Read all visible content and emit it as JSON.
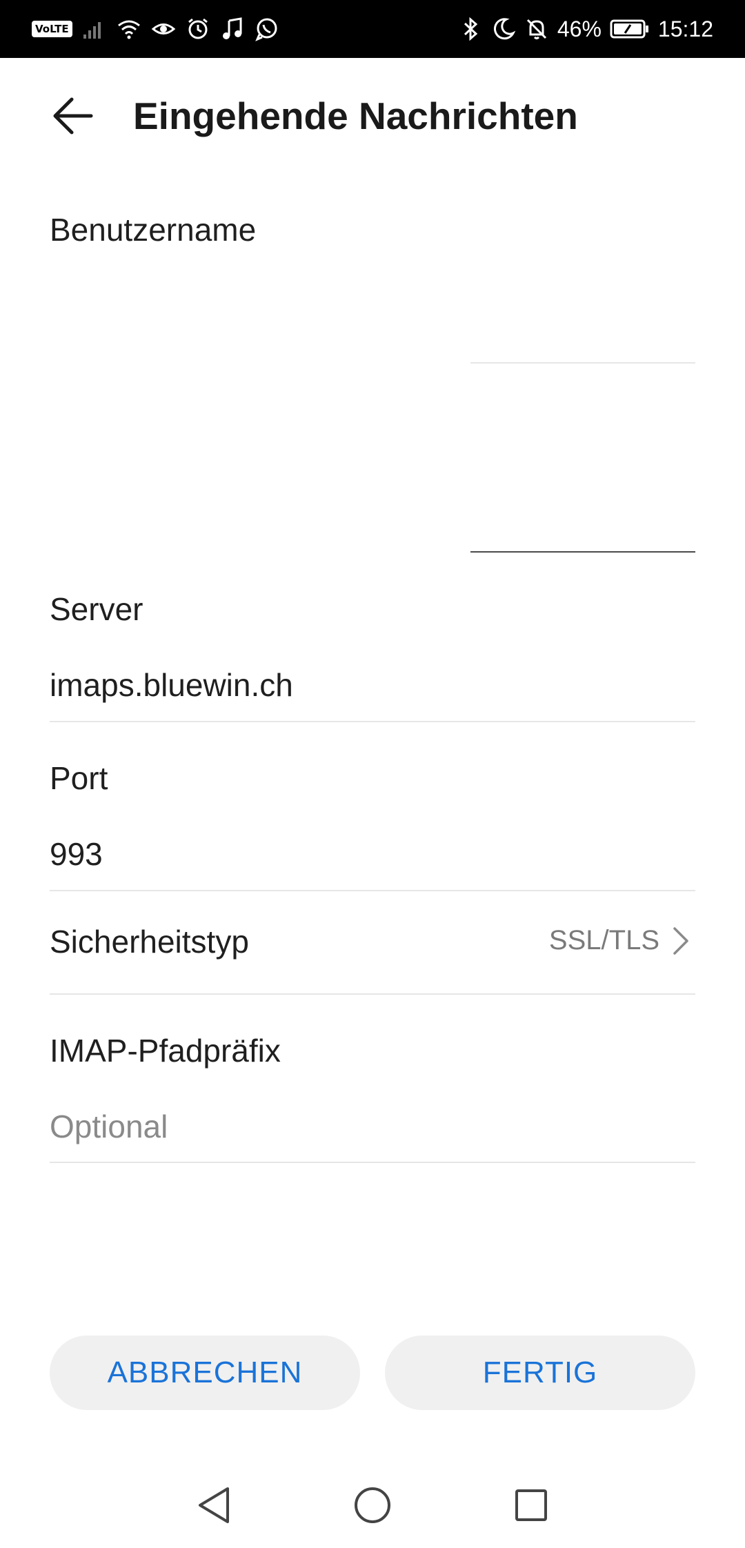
{
  "status_bar": {
    "volte": "VoLTE",
    "battery_percent": "46%",
    "time": "15:12",
    "icons_left": [
      "signal-icon",
      "wifi-icon",
      "eye-icon",
      "alarm-icon",
      "music-icon",
      "whatsapp-icon"
    ],
    "icons_right": [
      "bluetooth-icon",
      "moon-icon",
      "bell-off-icon",
      "battery-icon"
    ]
  },
  "header": {
    "title": "Eingehende Nachrichten",
    "back_icon": "arrow-left-icon"
  },
  "form": {
    "username": {
      "label": "Benutzername",
      "value": "",
      "password_value": ""
    },
    "server": {
      "label": "Server",
      "value": "imaps.bluewin.ch"
    },
    "port": {
      "label": "Port",
      "value": "993"
    },
    "security": {
      "label": "Sicherheitstyp",
      "value": "SSL/TLS"
    },
    "imap_prefix": {
      "label": "IMAP-Pfadpräfix",
      "placeholder": "Optional",
      "value": ""
    }
  },
  "actions": {
    "cancel_label": "ABBRECHEN",
    "done_label": "FERTIG",
    "accent_color": "#1a73d8"
  },
  "nav": {
    "back_icon": "triangle-back-icon",
    "home_icon": "circle-home-icon",
    "recents_icon": "square-recents-icon"
  }
}
